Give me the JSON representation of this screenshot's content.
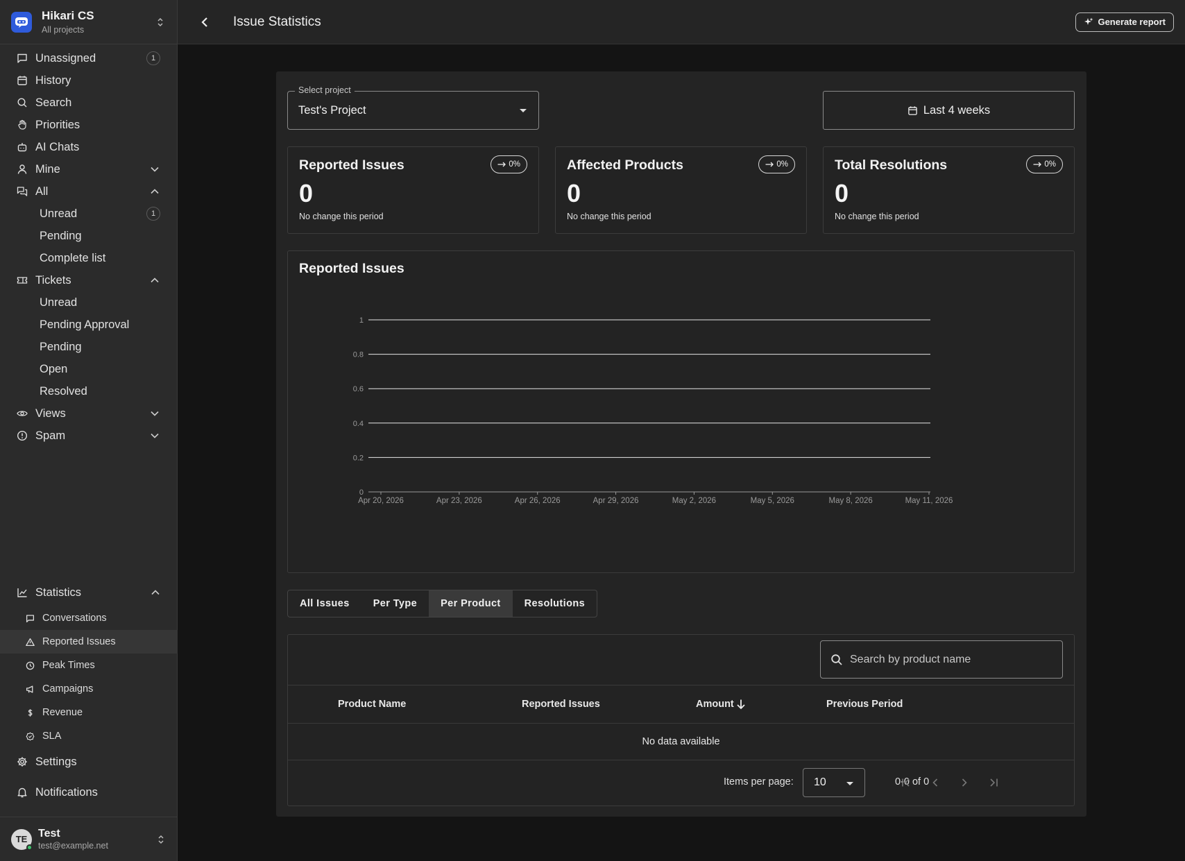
{
  "workspace": {
    "name": "Hikari CS",
    "subtitle": "All projects"
  },
  "sidebar": {
    "items": [
      {
        "label": "Unassigned",
        "icon": "message-square-icon",
        "badge": "1"
      },
      {
        "label": "History",
        "icon": "calendar-icon"
      },
      {
        "label": "Search",
        "icon": "search-icon"
      },
      {
        "label": "Priorities",
        "icon": "hand-icon"
      },
      {
        "label": "AI Chats",
        "icon": "bot-icon"
      },
      {
        "label": "Mine",
        "icon": "user-icon"
      },
      {
        "label": "All",
        "icon": "messages-icon"
      }
    ],
    "all_sub": [
      {
        "label": "Unread",
        "badge": "1"
      },
      {
        "label": "Pending"
      },
      {
        "label": "Complete list"
      }
    ],
    "tickets": {
      "label": "Tickets",
      "icon": "ticket-icon"
    },
    "tickets_sub": [
      "Unread",
      "Pending Approval",
      "Pending",
      "Open",
      "Resolved"
    ],
    "views": {
      "label": "Views",
      "icon": "eye-icon"
    },
    "spam": {
      "label": "Spam",
      "icon": "alert-circle-icon"
    },
    "statistics": {
      "label": "Statistics",
      "icon": "line-chart-icon"
    },
    "stats_sub": [
      {
        "label": "Conversations",
        "icon": "message-square-icon"
      },
      {
        "label": "Reported Issues",
        "icon": "alert-triangle-icon"
      },
      {
        "label": "Peak Times",
        "icon": "clock-icon"
      },
      {
        "label": "Campaigns",
        "icon": "megaphone-icon"
      },
      {
        "label": "Revenue",
        "icon": "dollar-icon"
      },
      {
        "label": "SLA",
        "icon": "badge-icon"
      }
    ],
    "settings": "Settings",
    "notifications": "Notifications"
  },
  "user": {
    "initials": "TE",
    "name": "Test",
    "email": "test@example.net"
  },
  "header": {
    "title": "Issue Statistics",
    "generate_label": "Generate report"
  },
  "filters": {
    "project_legend": "Select project",
    "project_value": "Test's Project",
    "date_range": "Last 4 weeks"
  },
  "stats": [
    {
      "title": "Reported Issues",
      "change": "0%",
      "value": "0",
      "note": "No change this period"
    },
    {
      "title": "Affected Products",
      "change": "0%",
      "value": "0",
      "note": "No change this period"
    },
    {
      "title": "Total Resolutions",
      "change": "0%",
      "value": "0",
      "note": "No change this period"
    }
  ],
  "chart_data": {
    "type": "line",
    "title": "Reported Issues",
    "x": [
      "Apr 20, 2026",
      "Apr 23, 2026",
      "Apr 26, 2026",
      "Apr 29, 2026",
      "May 2, 2026",
      "May 5, 2026",
      "May 8, 2026",
      "May 11, 2026"
    ],
    "y_ticks": [
      "0",
      "0.2",
      "0.4",
      "0.6",
      "0.8",
      "1"
    ],
    "ylim": [
      0,
      1
    ],
    "series": [],
    "grid": true
  },
  "tabs": [
    "All Issues",
    "Per Type",
    "Per Product",
    "Resolutions"
  ],
  "active_tab": "Per Product",
  "table": {
    "search_placeholder": "Search by product name",
    "columns": [
      "Product Name",
      "Reported Issues",
      "Amount",
      "Previous Period"
    ],
    "empty_text": "No data available",
    "items_per_page_label": "Items per page:",
    "items_per_page": "10",
    "range": "0-0 of 0"
  }
}
